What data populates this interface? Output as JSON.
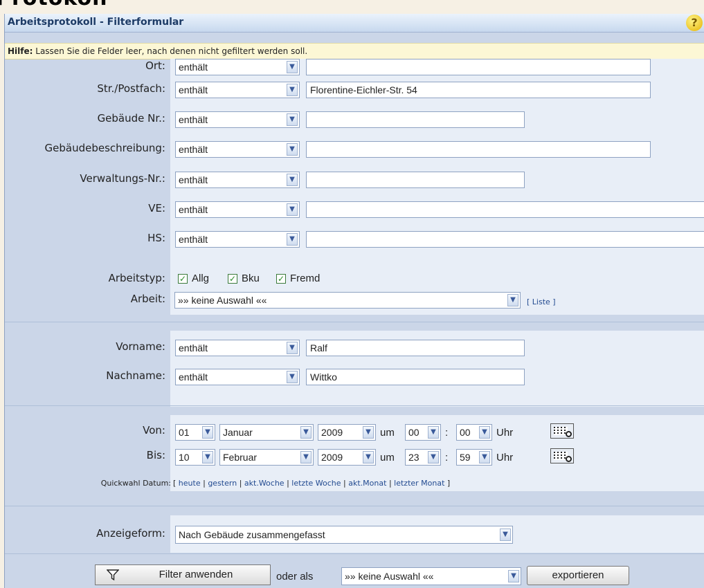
{
  "background_title": "Protokoll",
  "window": {
    "title": "Arbeitsprotokoll - Filterformular",
    "help_icon": "?"
  },
  "hint": {
    "label": "Hilfe:",
    "text": "Lassen Sie die Felder leer, nach denen nicht gefiltert werden soll."
  },
  "fields": [
    {
      "label": "Ort:",
      "operator": "enthält",
      "value": ""
    },
    {
      "label": "Str./Postfach:",
      "operator": "enthält",
      "value": "Florentine-Eichler-Str. 54"
    },
    {
      "label": "Gebäude Nr.:",
      "operator": "enthält",
      "value": ""
    },
    {
      "label": "Gebäudebeschreibung:",
      "operator": "enthält",
      "value": ""
    },
    {
      "label": "Verwaltungs-Nr.:",
      "operator": "enthält",
      "value": ""
    },
    {
      "label": "VE:",
      "operator": "enthält",
      "value": ""
    },
    {
      "label": "HS:",
      "operator": "enthält",
      "value": ""
    }
  ],
  "arbeitstyp": {
    "label": "Arbeitstyp:",
    "options": [
      {
        "label": "Allg",
        "checked": true
      },
      {
        "label": "Bku",
        "checked": true
      },
      {
        "label": "Fremd",
        "checked": true
      }
    ]
  },
  "arbeit": {
    "label": "Arbeit:",
    "value": "»» keine Auswahl ««",
    "link": "[ Liste ]"
  },
  "person": [
    {
      "label": "Vorname:",
      "operator": "enthält",
      "value": "Ralf"
    },
    {
      "label": "Nachname:",
      "operator": "enthält",
      "value": "Wittko"
    }
  ],
  "dates": [
    {
      "label": "Von:",
      "day": "01",
      "month": "Januar",
      "year": "2009",
      "um": "um",
      "hour": "00",
      "colon": ":",
      "minute": "00",
      "uhr": "Uhr"
    },
    {
      "label": "Bis:",
      "day": "10",
      "month": "Februar",
      "year": "2009",
      "um": "um",
      "hour": "23",
      "colon": ":",
      "minute": "59",
      "uhr": "Uhr"
    }
  ],
  "quickwahl": {
    "label": "Quickwahl Datum:",
    "open": "[",
    "close": "]",
    "links": [
      "heute",
      "gestern",
      "akt.Woche",
      "letzte Woche",
      "akt.Monat",
      "letzter Monat"
    ],
    "sep": "|"
  },
  "anzeige": {
    "label": "Anzeigeform:",
    "value": "Nach Gebäude zusammengefasst"
  },
  "footer": {
    "filter_button": "Filter anwenden",
    "oder_als": "oder als",
    "export_select": "»» keine Auswahl ««",
    "export_button": "exportieren"
  },
  "icons": {
    "filter": "filter-icon",
    "calendar": "calendar-icon",
    "dropdown": "chevron-down-icon"
  }
}
